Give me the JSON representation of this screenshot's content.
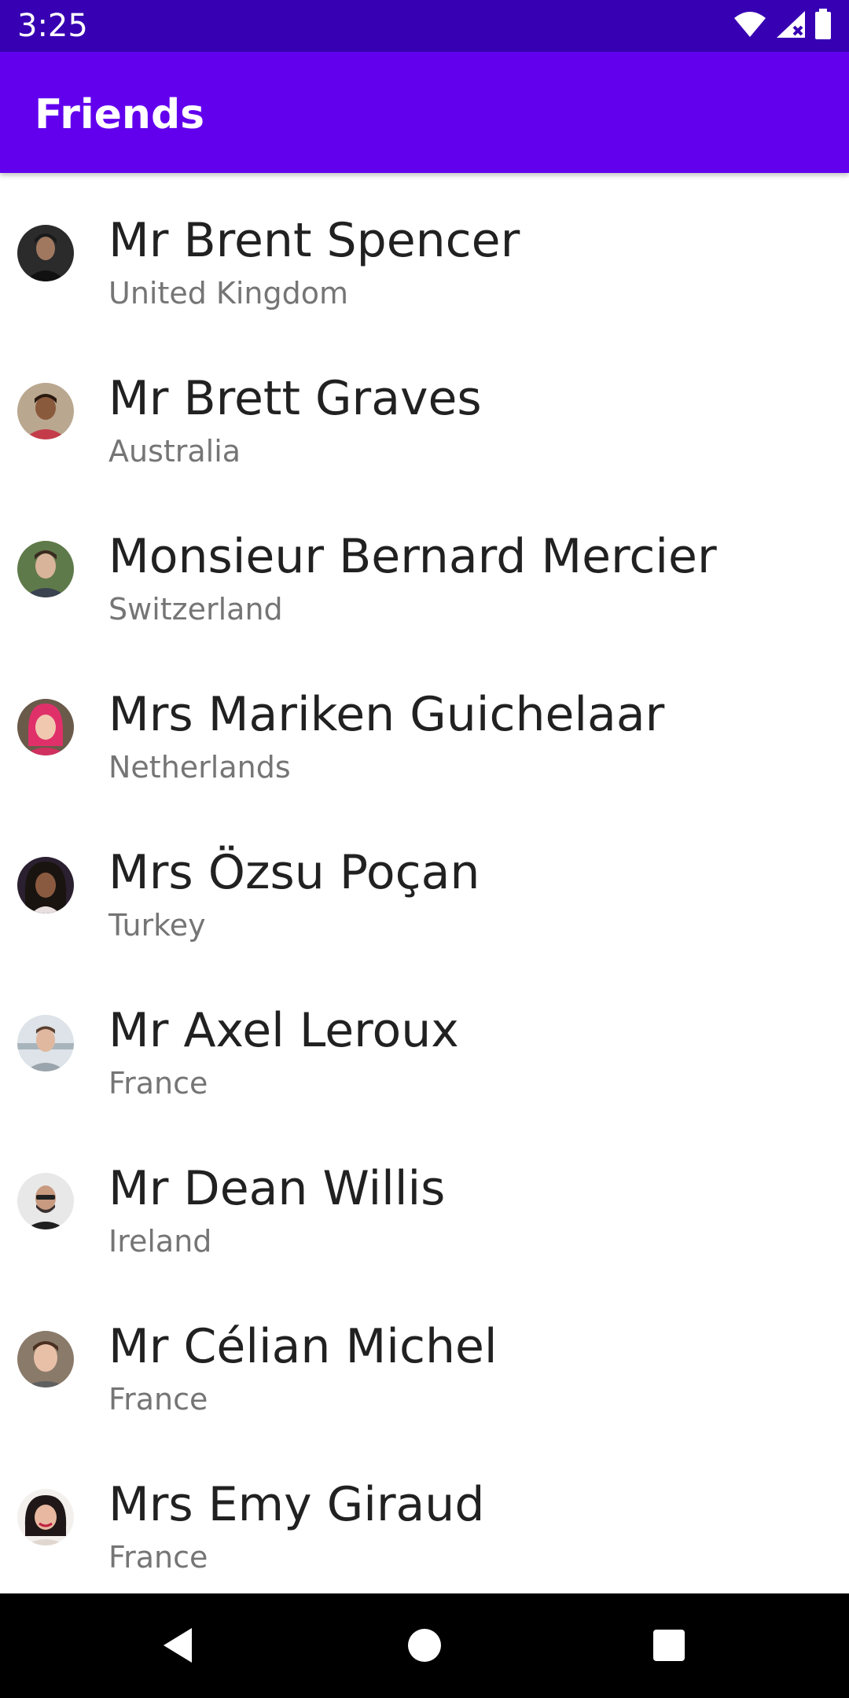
{
  "status_bar": {
    "time": "3:25",
    "icons": [
      "wifi-icon",
      "cellular-signal-icon",
      "battery-icon"
    ]
  },
  "app_bar": {
    "title": "Friends",
    "color": "#6200ee",
    "status_color": "#3700b3"
  },
  "friends": [
    {
      "name": "Mr Brent Spencer",
      "country": "United Kingdom",
      "avatar": "avatar-photo"
    },
    {
      "name": "Mr Brett Graves",
      "country": "Australia",
      "avatar": "avatar-photo"
    },
    {
      "name": "Monsieur Bernard Mercier",
      "country": "Switzerland",
      "avatar": "avatar-photo"
    },
    {
      "name": "Mrs Mariken Guichelaar",
      "country": "Netherlands",
      "avatar": "avatar-photo"
    },
    {
      "name": "Mrs Özsu Poçan",
      "country": "Turkey",
      "avatar": "avatar-photo"
    },
    {
      "name": "Mr Axel Leroux",
      "country": "France",
      "avatar": "avatar-photo"
    },
    {
      "name": "Mr Dean Willis",
      "country": "Ireland",
      "avatar": "avatar-photo"
    },
    {
      "name": "Mr Célian Michel",
      "country": "France",
      "avatar": "avatar-photo"
    },
    {
      "name": "Mrs Emy Giraud",
      "country": "France",
      "avatar": "avatar-photo"
    }
  ],
  "nav_bar": {
    "buttons": [
      "back-icon",
      "home-icon",
      "recents-icon"
    ]
  }
}
